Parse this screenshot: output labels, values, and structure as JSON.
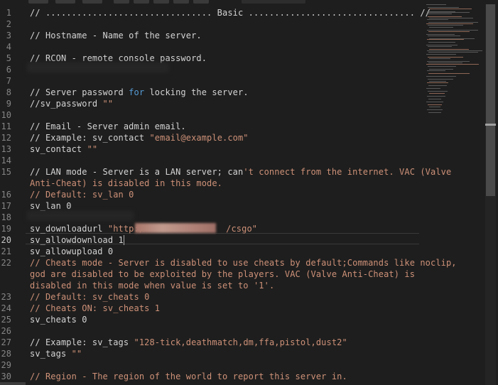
{
  "editor": {
    "line_numbers": [
      "1",
      "2",
      "3",
      "4",
      "5",
      "6",
      "7",
      "8",
      "9",
      "10",
      "11",
      "12",
      "13",
      "14",
      "15",
      "",
      "16",
      "17",
      "18",
      "19",
      "20",
      "21",
      "22",
      "",
      "",
      "23",
      "24",
      "25",
      "26",
      "27",
      "28",
      "29",
      "30"
    ],
    "active_line": "20",
    "lines": {
      "l1": "// ................................ Basic ................................ //",
      "l3": "// Hostname - Name of the server.",
      "l5": "// RCON - remote console password.",
      "l8a": "// Server password ",
      "l8kw": "for",
      "l8b": " locking the server.",
      "l9a": "//sv_password ",
      "l9s": "\"\"",
      "l11": "// Email - Server admin email.",
      "l12a": "// Example: sv_contact ",
      "l12s": "\"email@example.com\"",
      "l13a": "sv_contact ",
      "l13s": "\"\"",
      "l15a": "// LAN mode - Server is a LAN server; can",
      "l15s": "'t connect from the internet. VAC (Valve",
      "l15w": "Anti-Cheat) is disabled in this mode.",
      "l16": "// Default: sv_lan 0",
      "l17": "sv_lan 0",
      "l19a": "sv_downloadurl ",
      "l19s1": "\"http:/",
      "l19s2": "/csgo\"",
      "l20a": "sv_allowdownload 1",
      "l21": "sv_allowupload 0",
      "l22": "// Cheats mode - Server is disabled to use cheats by default;Commands like noclip,",
      "l22w1": "god are disabled to be exploited by the players. VAC (Valve Anti-Cheat) is",
      "l22w2a": "disabled in this mode when value is set to ",
      "l22w2s": "'1'",
      "l22w2b": ".",
      "l23": "// Default: sv_cheats 0",
      "l24": "// Cheats ON: sv_cheats 1",
      "l25": "sv_cheats 0",
      "l27a": "// Example: sv_tags ",
      "l27s": "\"128-tick,deathmatch,dm,ffa,pistol,dust2\"",
      "l28a": "sv_tags ",
      "l28s": "\"\"",
      "l30": "// Region - The region of the world to report this server in."
    }
  },
  "colors": {
    "background": "#1e1e1e",
    "text": "#d4d4d4",
    "string": "#ce9178",
    "keyword": "#569cd6",
    "line_number": "#858585"
  }
}
